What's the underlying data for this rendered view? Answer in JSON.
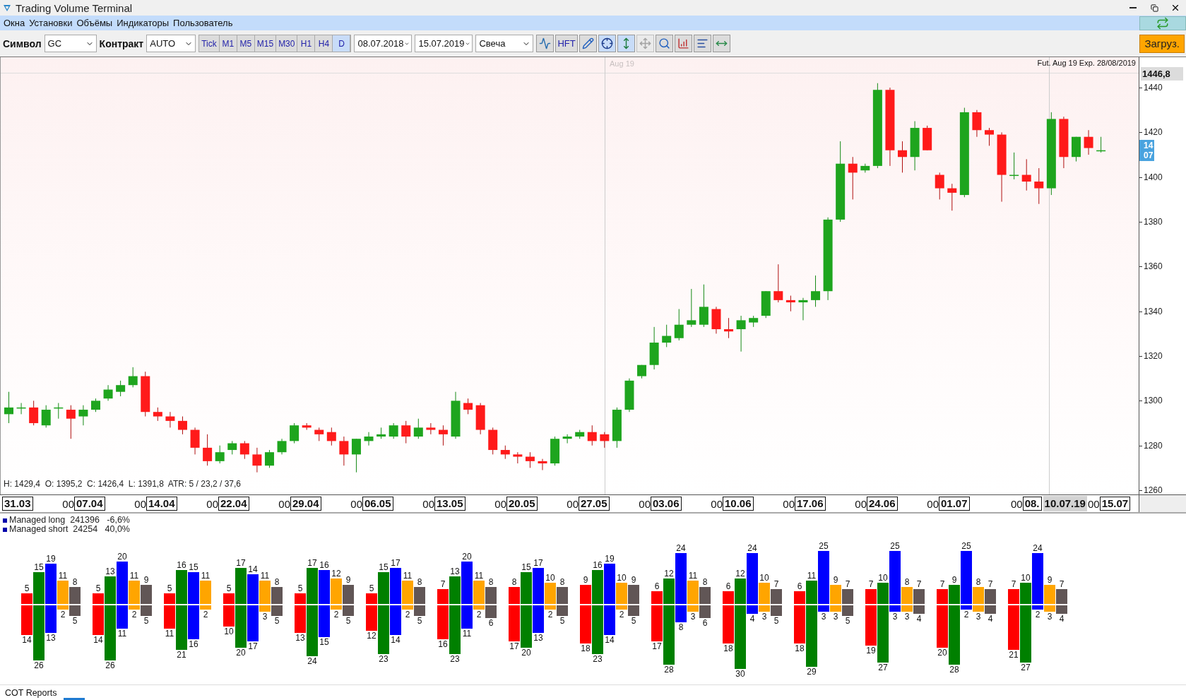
{
  "window": {
    "title": "Trading Volume Terminal"
  },
  "menu": [
    "Окна",
    "Установки",
    "Объёмы",
    "Индикаторы",
    "Пользователь"
  ],
  "toolbar": {
    "symbol_label": "Символ",
    "symbol": "GC",
    "contract_label": "Контракт",
    "contract": "AUTO",
    "timeframes": [
      {
        "label": "Tick",
        "selected": false
      },
      {
        "label": "M1",
        "selected": false
      },
      {
        "label": "M5",
        "selected": false
      },
      {
        "label": "M15",
        "selected": false
      },
      {
        "label": "M30",
        "selected": false
      },
      {
        "label": "H1",
        "selected": false
      },
      {
        "label": "H4",
        "selected": false
      },
      {
        "label": "D",
        "selected": true
      }
    ],
    "date_from": "08.07.2018",
    "date_to": "15.07.2019",
    "chart_type": "Свеча",
    "tools": [
      {
        "kind": "flow",
        "selected": false,
        "disabled": false
      },
      {
        "kind": "text",
        "label": "HFT",
        "selected": false,
        "disabled": false
      },
      {
        "kind": "pencil",
        "selected": false,
        "disabled": false
      },
      {
        "kind": "crosshair",
        "selected": true,
        "disabled": false
      },
      {
        "kind": "vscale",
        "selected": true,
        "disabled": false
      },
      {
        "kind": "move",
        "selected": false,
        "disabled": true
      },
      {
        "kind": "zoom",
        "selected": false,
        "disabled": false
      },
      {
        "kind": "bars",
        "selected": false,
        "disabled": false
      },
      {
        "kind": "profile",
        "selected": false,
        "disabled": false
      },
      {
        "kind": "ruler",
        "selected": false,
        "disabled": false
      }
    ],
    "load_button": "Загруз."
  },
  "price_chart": {
    "contract_label": "Aug 19",
    "expiry": "Fut. Aug 19 Exp. 28/08/2019",
    "last_price": "1446,8",
    "price_marker": [
      "14",
      "07"
    ],
    "info": "H: 1429,4  O: 1395,2  C: 1426,4  L: 1391,8  ATR: 5 / 23,2 / 37,6",
    "chart_data": {
      "type": "candlestick",
      "ylim": [
        1257.8,
        1453.6
      ],
      "ref_lines": [
        {
          "axis": "y",
          "value": 1446.8
        }
      ],
      "categories": [
        null,
        null,
        null,
        null,
        null,
        null,
        null,
        null,
        null,
        null,
        null,
        null,
        null,
        null,
        null,
        null,
        null,
        null,
        null,
        null,
        null,
        null,
        null,
        null,
        null,
        null,
        null,
        null,
        null,
        null,
        null,
        null,
        null,
        null,
        null,
        null,
        null,
        null,
        null,
        null,
        null,
        null,
        null,
        null,
        null,
        null,
        null,
        null,
        null,
        null,
        null,
        null,
        null,
        null,
        null,
        null,
        null,
        null,
        null,
        null,
        null,
        null,
        null,
        null,
        null,
        null,
        null,
        null,
        null,
        null,
        null,
        null,
        null,
        null,
        null,
        null,
        null,
        null,
        null,
        null,
        null,
        null,
        null,
        null,
        null,
        null,
        null,
        null,
        null
      ],
      "yticks": [
        {
          "value": 1440,
          "label": "1440"
        },
        {
          "value": 1420,
          "label": "1420"
        },
        {
          "value": 1400,
          "label": "1400"
        },
        {
          "value": 1380,
          "label": "1380"
        },
        {
          "value": 1360,
          "label": "1360"
        },
        {
          "value": 1340,
          "label": "1340"
        },
        {
          "value": 1320,
          "label": "1320"
        },
        {
          "value": 1300,
          "label": "1300"
        },
        {
          "value": 1280,
          "label": "1280"
        },
        {
          "value": 1260,
          "label": "1260"
        }
      ],
      "ohlc": [
        [
          1294,
          1304,
          1290,
          1297
        ],
        [
          1297,
          1299,
          1294,
          1297
        ],
        [
          1297,
          1300,
          1289,
          1290
        ],
        [
          1289,
          1298,
          1288,
          1296
        ],
        [
          1297,
          1299,
          1292,
          1297
        ],
        [
          1296,
          1298,
          1283,
          1292
        ],
        [
          1293,
          1298,
          1289,
          1296
        ],
        [
          1296,
          1301,
          1295,
          1300
        ],
        [
          1301,
          1307,
          1300,
          1305
        ],
        [
          1304,
          1309,
          1302,
          1307
        ],
        [
          1307,
          1315,
          1306,
          1311
        ],
        [
          1311,
          1313,
          1293,
          1295
        ],
        [
          1295,
          1297,
          1291,
          1293
        ],
        [
          1293,
          1295,
          1288,
          1291
        ],
        [
          1291,
          1293,
          1285,
          1287
        ],
        [
          1287,
          1288,
          1276,
          1279
        ],
        [
          1279,
          1285,
          1271,
          1273
        ],
        [
          1273,
          1280,
          1272,
          1277
        ],
        [
          1278,
          1282,
          1276,
          1281
        ],
        [
          1281,
          1282,
          1274,
          1276
        ],
        [
          1276,
          1279,
          1268,
          1271
        ],
        [
          1271,
          1278,
          1270,
          1277
        ],
        [
          1277,
          1283,
          1276,
          1282
        ],
        [
          1282,
          1290,
          1281,
          1289
        ],
        [
          1289,
          1290,
          1287,
          1288
        ],
        [
          1287,
          1288,
          1282,
          1285
        ],
        [
          1286,
          1288,
          1280,
          1282
        ],
        [
          1282,
          1284,
          1271,
          1276
        ],
        [
          1276,
          1283,
          1268,
          1283
        ],
        [
          1282,
          1286,
          1280,
          1284
        ],
        [
          1284,
          1288,
          1283,
          1285
        ],
        [
          1284,
          1290,
          1283,
          1289
        ],
        [
          1289,
          1291,
          1281,
          1284
        ],
        [
          1284,
          1292,
          1283,
          1288
        ],
        [
          1288,
          1290,
          1285,
          1287
        ],
        [
          1287,
          1289,
          1280,
          1285
        ],
        [
          1284,
          1304,
          1283,
          1300
        ],
        [
          1299,
          1301,
          1294,
          1296
        ],
        [
          1298,
          1299,
          1285,
          1287
        ],
        [
          1287,
          1288,
          1276,
          1278
        ],
        [
          1278,
          1280,
          1274,
          1276
        ],
        [
          1276,
          1277,
          1272,
          1275
        ],
        [
          1275,
          1277,
          1270,
          1273
        ],
        [
          1273,
          1274,
          1269,
          1272
        ],
        [
          1272,
          1284,
          1271,
          1283
        ],
        [
          1283,
          1285,
          1281,
          1284
        ],
        [
          1284,
          1287,
          1283,
          1286
        ],
        [
          1286,
          1289,
          1280,
          1282
        ],
        [
          1285,
          1286,
          1279,
          1282
        ],
        [
          1282,
          1297,
          1279,
          1296
        ],
        [
          1296,
          1310,
          1295,
          1309
        ],
        [
          1311,
          1316,
          1310,
          1316
        ],
        [
          1316,
          1333,
          1314,
          1326
        ],
        [
          1326,
          1334,
          1324,
          1329
        ],
        [
          1328,
          1341,
          1327,
          1334
        ],
        [
          1334,
          1350,
          1333,
          1336
        ],
        [
          1334,
          1352,
          1333,
          1342
        ],
        [
          1341,
          1342,
          1330,
          1332
        ],
        [
          1332,
          1337,
          1328,
          1331
        ],
        [
          1332,
          1338,
          1322,
          1336
        ],
        [
          1335,
          1338,
          1333,
          1337
        ],
        [
          1338,
          1349,
          1337,
          1349
        ],
        [
          1349,
          1361,
          1344,
          1345
        ],
        [
          1345,
          1347,
          1340,
          1344
        ],
        [
          1344,
          1346,
          1336,
          1345
        ],
        [
          1345,
          1356,
          1342,
          1349
        ],
        [
          1349,
          1382,
          1345,
          1381
        ],
        [
          1381,
          1416,
          1380,
          1406
        ],
        [
          1406,
          1409,
          1390,
          1402
        ],
        [
          1403,
          1406,
          1402,
          1405
        ],
        [
          1405,
          1442,
          1404,
          1439
        ],
        [
          1439,
          1440,
          1405,
          1412
        ],
        [
          1412,
          1416,
          1402,
          1409
        ],
        [
          1409,
          1425,
          1403,
          1422
        ],
        [
          1422,
          1423,
          1412,
          1412
        ],
        [
          1401,
          1402,
          1390,
          1395
        ],
        [
          1395,
          1397,
          1385,
          1393
        ],
        [
          1392,
          1431,
          1391,
          1429
        ],
        [
          1429,
          1430,
          1418,
          1421
        ],
        [
          1421,
          1422,
          1414,
          1419
        ],
        [
          1419,
          1420,
          1389,
          1401
        ],
        [
          1401,
          1411,
          1399,
          1401
        ],
        [
          1401,
          1408,
          1394,
          1398
        ],
        [
          1398,
          1404,
          1388,
          1395
        ],
        [
          1395,
          1429,
          1392,
          1426
        ],
        [
          1426,
          1427,
          1404,
          1409
        ],
        [
          1409,
          1418,
          1407,
          1418
        ],
        [
          1418,
          1421,
          1410,
          1413
        ],
        [
          1412,
          1418,
          1411,
          1412
        ]
      ]
    }
  },
  "x_axis": {
    "first": "31.03",
    "weeks": [
      {
        "prefix": "00",
        "date": "07.04"
      },
      {
        "prefix": "00",
        "date": "14.04"
      },
      {
        "prefix": "00",
        "date": "22.04"
      },
      {
        "prefix": "00",
        "date": "29.04"
      },
      {
        "prefix": "00",
        "date": "06.05"
      },
      {
        "prefix": "00",
        "date": "13.05"
      },
      {
        "prefix": "00",
        "date": "20.05"
      },
      {
        "prefix": "00",
        "date": "27.05"
      },
      {
        "prefix": "00",
        "date": "03.06"
      },
      {
        "prefix": "00",
        "date": "10.06"
      },
      {
        "prefix": "00",
        "date": "17.06"
      },
      {
        "prefix": "00",
        "date": "24.06"
      },
      {
        "prefix": "00",
        "date": "01.07"
      },
      {
        "prefix": "00",
        "date": "08."
      },
      {
        "kind": "cursor",
        "date": "10.07.19"
      },
      {
        "prefix": "00",
        "date": "15.07"
      }
    ]
  },
  "cot": {
    "legend": [
      {
        "name": "Managed long",
        "value": "241396",
        "change": "-6,6%"
      },
      {
        "name": "Managed short",
        "value": "24254",
        "change": "40,0%"
      }
    ],
    "series": [
      {
        "color": "#ff0000"
      },
      {
        "color": "#008000"
      },
      {
        "color": "#0000ff"
      },
      {
        "color": "#ffa500"
      },
      {
        "color": "#615656"
      }
    ],
    "groups": [
      [
        [
          "5",
          "14"
        ],
        [
          "15",
          "26"
        ],
        [
          "19",
          "13"
        ],
        [
          "11",
          "2"
        ],
        [
          "8",
          "5"
        ]
      ],
      [
        [
          "5",
          "14"
        ],
        [
          "13",
          "26"
        ],
        [
          "20",
          "11"
        ],
        [
          "11",
          "2"
        ],
        [
          "9",
          "5"
        ]
      ],
      [
        [
          "5",
          "11"
        ],
        [
          "16",
          "21"
        ],
        [
          "15",
          "16"
        ],
        [
          "11",
          "2"
        ]
      ],
      [
        [
          "5",
          "10"
        ],
        [
          "17",
          "20"
        ],
        [
          "14",
          "17"
        ],
        [
          "11",
          "3"
        ],
        [
          "8",
          "5"
        ]
      ],
      [
        [
          "5",
          "13"
        ],
        [
          "17",
          "24"
        ],
        [
          "16",
          "15"
        ],
        [
          "12",
          "2"
        ],
        [
          "9",
          "5"
        ]
      ],
      [
        [
          "5",
          "12"
        ],
        [
          "15",
          "23"
        ],
        [
          "17",
          "14"
        ],
        [
          "11",
          "2"
        ],
        [
          "8",
          "5"
        ]
      ],
      [
        [
          "7",
          "16"
        ],
        [
          "13",
          "23"
        ],
        [
          "20",
          "11"
        ],
        [
          "11",
          "2"
        ],
        [
          "8",
          "6"
        ]
      ],
      [
        [
          "8",
          "17"
        ],
        [
          "15",
          "20"
        ],
        [
          "17",
          "13"
        ],
        [
          "10",
          "2"
        ],
        [
          "8",
          "5"
        ]
      ],
      [
        [
          "9",
          "18"
        ],
        [
          "16",
          "23"
        ],
        [
          "19",
          "14"
        ],
        [
          "10",
          "2"
        ],
        [
          "9",
          "5"
        ]
      ],
      [
        [
          "6",
          "17"
        ],
        [
          "12",
          "28"
        ],
        [
          "24",
          "8"
        ],
        [
          "11",
          "3"
        ],
        [
          "8",
          "6"
        ]
      ],
      [
        [
          "6",
          "18"
        ],
        [
          "12",
          "30"
        ],
        [
          "24",
          "4"
        ],
        [
          "10",
          "3"
        ],
        [
          "7",
          "5"
        ]
      ],
      [
        [
          "6",
          "18"
        ],
        [
          "11",
          "29"
        ],
        [
          "25",
          "3"
        ],
        [
          "9",
          "3"
        ],
        [
          "7",
          "5"
        ]
      ],
      [
        [
          "7",
          "19"
        ],
        [
          "10",
          "27"
        ],
        [
          "25",
          "3"
        ],
        [
          "8",
          "3"
        ],
        [
          "7",
          "4"
        ]
      ],
      [
        [
          "7",
          "20"
        ],
        [
          "9",
          "28"
        ],
        [
          "25",
          "2"
        ],
        [
          "8",
          "3"
        ],
        [
          "7",
          "4"
        ]
      ],
      [
        [
          "7",
          "21"
        ],
        [
          "10",
          "27"
        ],
        [
          "24",
          "2"
        ],
        [
          "9",
          "3"
        ],
        [
          "7",
          "4"
        ]
      ]
    ],
    "tab": "COT Reports"
  }
}
